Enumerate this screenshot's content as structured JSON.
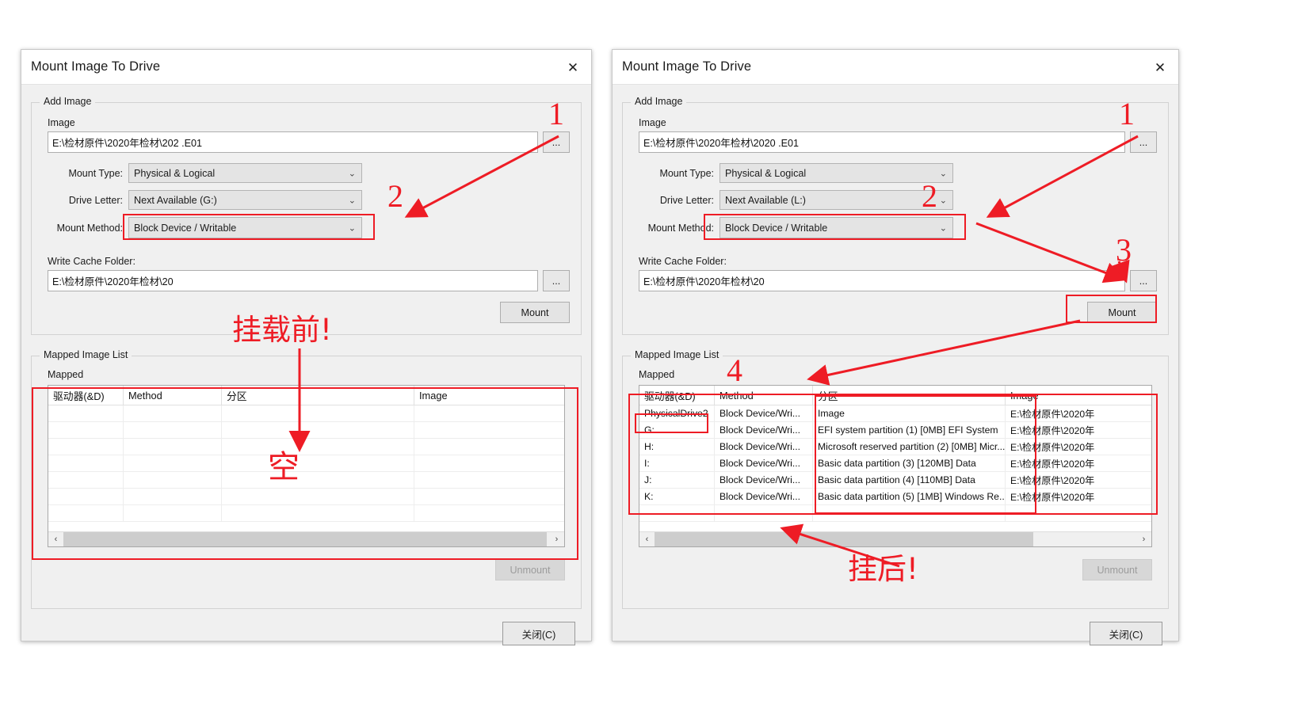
{
  "dialogs": [
    {
      "key": "before",
      "title": "Mount Image To Drive",
      "close_icon": "✕",
      "add_image": {
        "legend": "Add Image",
        "image_label": "Image",
        "image_value": "E:\\检材原件\\2020年检材\\202                    .E01",
        "browse_label": "...",
        "mount_type_label": "Mount Type:",
        "mount_type_value": "Physical & Logical",
        "drive_letter_label": "Drive Letter:",
        "drive_letter_value": "Next Available (G:)",
        "mount_method_label": "Mount Method:",
        "mount_method_value": "Block Device / Writable",
        "write_cache_label": "Write Cache Folder:",
        "write_cache_value": "E:\\检材原件\\2020年检材\\20",
        "write_cache_browse": "...",
        "mount_button": "Mount"
      },
      "mapped": {
        "legend": "Mapped Image List",
        "sub_label": "Mapped",
        "columns": [
          "驱动器(&D)",
          "Method",
          "分区",
          "Image"
        ],
        "rows": [],
        "empty_rows": 7,
        "unmount_button": "Unmount"
      },
      "close_button": "关闭(C)"
    },
    {
      "key": "after",
      "title": "Mount Image To Drive",
      "close_icon": "✕",
      "add_image": {
        "legend": "Add Image",
        "image_label": "Image",
        "image_value": "E:\\检材原件\\2020年检材\\2020                  .E01",
        "browse_label": "...",
        "mount_type_label": "Mount Type:",
        "mount_type_value": "Physical & Logical",
        "drive_letter_label": "Drive Letter:",
        "drive_letter_value": "Next Available (L:)",
        "mount_method_label": "Mount Method:",
        "mount_method_value": "Block Device / Writable",
        "write_cache_label": "Write Cache Folder:",
        "write_cache_value": "E:\\检材原件\\2020年检材\\20",
        "write_cache_browse": "...",
        "mount_button": "Mount"
      },
      "mapped": {
        "legend": "Mapped Image List",
        "sub_label": "Mapped",
        "columns": [
          "驱动器(&D)",
          "Method",
          "分区",
          "Image"
        ],
        "rows": [
          [
            "PhysicalDrive2",
            "Block Device/Wri...",
            "Image",
            "E:\\检材原件\\2020年"
          ],
          [
            "G:",
            "Block Device/Wri...",
            "EFI system partition (1) [0MB] EFI System",
            "E:\\检材原件\\2020年"
          ],
          [
            "H:",
            "Block Device/Wri...",
            "Microsoft reserved partition (2) [0MB] Micr...",
            "E:\\检材原件\\2020年"
          ],
          [
            "I:",
            "Block Device/Wri...",
            "Basic data partition (3) [120MB] Data",
            "E:\\检材原件\\2020年"
          ],
          [
            "J:",
            "Block Device/Wri...",
            "Basic data partition (4) [110MB] Data",
            "E:\\检材原件\\2020年"
          ],
          [
            "K:",
            "Block Device/Wri...",
            "Basic data partition (5) [1MB] Windows Re...",
            "E:\\检材原件\\2020年"
          ]
        ],
        "empty_rows": 1,
        "unmount_button": "Unmount"
      },
      "close_button": "关闭(C)"
    }
  ],
  "annotations": {
    "left": {
      "step1": "1",
      "step2": "2",
      "caption_before": "挂载前!",
      "caption_empty": "空"
    },
    "right": {
      "step1": "1",
      "step2": "2",
      "step3": "3",
      "step4": "4",
      "caption_after": "挂后!"
    },
    "color": "#ee1c25"
  },
  "scrollbar": {
    "left_arrow": "‹",
    "right_arrow": "›"
  }
}
